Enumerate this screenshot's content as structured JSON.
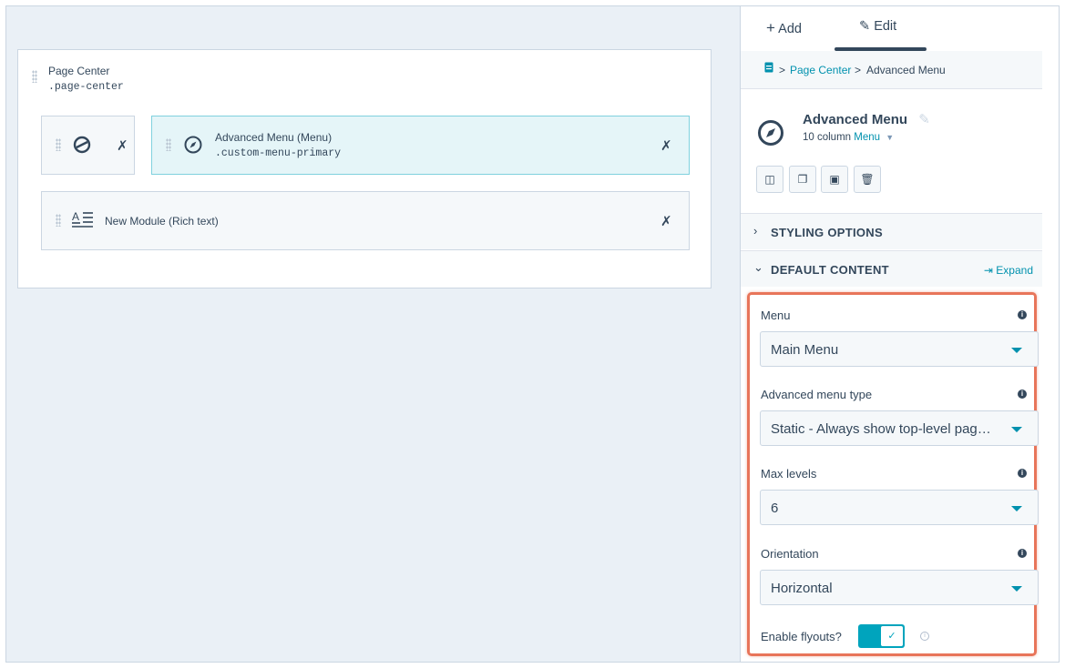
{
  "canvas": {
    "page_center": {
      "title": "Page Center",
      "class_name": ".page-center"
    },
    "modules": [
      {
        "name": "Advanced Menu (Menu)",
        "class_name": ".custom-menu-primary"
      },
      {
        "name": "New Module (Rich text)"
      }
    ]
  },
  "sidebar": {
    "tabs": [
      {
        "label": "Add",
        "icon": "plus-icon"
      },
      {
        "label": "Edit",
        "icon": "pencil-icon"
      }
    ],
    "active_tab": "Edit",
    "breadcrumb": {
      "root": "Page Center",
      "separator": ">",
      "current": "Advanced Menu"
    },
    "module_header": {
      "title": "Advanced Menu",
      "subtitle_prefix": "10 column",
      "subtitle_link": "Menu"
    },
    "sections": {
      "styling": "STYLING OPTIONS",
      "default_content": "DEFAULT CONTENT",
      "expand": "Expand"
    },
    "fields": [
      {
        "label": "Menu",
        "value": "Main Menu"
      },
      {
        "label": "Advanced menu type",
        "value": "Static - Always show top-level pag…"
      },
      {
        "label": "Max levels",
        "value": "6"
      },
      {
        "label": "Orientation",
        "value": "Horizontal"
      }
    ],
    "flyouts": {
      "label": "Enable flyouts?",
      "enabled": true
    }
  },
  "colors": {
    "accent": "#0091ae",
    "toggle": "#00a4bd",
    "highlight": "#e8755a",
    "text": "#33475b"
  }
}
